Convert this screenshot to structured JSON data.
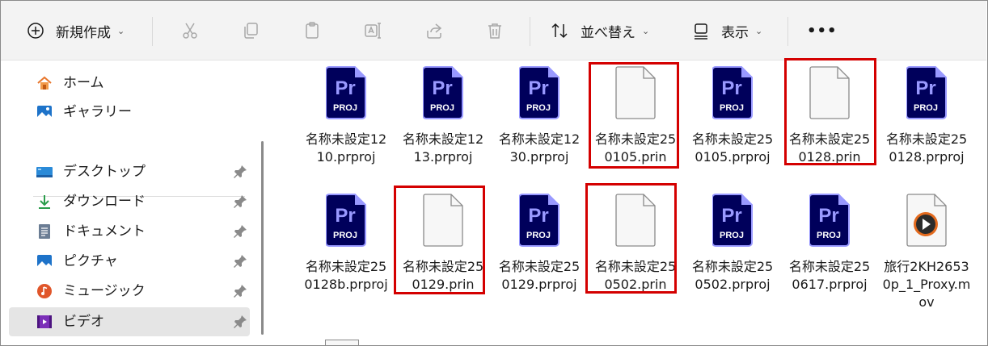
{
  "toolbar": {
    "new_label": "新規作成",
    "sort_label": "並べ替え",
    "view_label": "表示",
    "more_label": "•••"
  },
  "sidebar": {
    "items": [
      {
        "label": "ホーム",
        "icon": "home-icon"
      },
      {
        "label": "ギャラリー",
        "icon": "gallery-icon"
      },
      {
        "label": "デスクトップ",
        "icon": "desktop-icon"
      },
      {
        "label": "ダウンロード",
        "icon": "download-icon"
      },
      {
        "label": "ドキュメント",
        "icon": "documents-icon"
      },
      {
        "label": "ピクチャ",
        "icon": "pictures-icon"
      },
      {
        "label": "ミュージック",
        "icon": "music-icon"
      },
      {
        "label": "ビデオ",
        "icon": "video-icon",
        "selected": true
      }
    ]
  },
  "files": [
    {
      "name": "名称未設定1210.prproj",
      "type": "premiere",
      "highlighted": false
    },
    {
      "name": "名称未設定1213.prproj",
      "type": "premiere",
      "highlighted": false
    },
    {
      "name": "名称未設定1230.prproj",
      "type": "premiere",
      "highlighted": false
    },
    {
      "name": "名称未設定250105.prin",
      "type": "generic",
      "highlighted": true
    },
    {
      "name": "名称未設定250105.prproj",
      "type": "premiere",
      "highlighted": false
    },
    {
      "name": "名称未設定250128.prin",
      "type": "generic",
      "highlighted": true
    },
    {
      "name": "名称未設定250128.prproj",
      "type": "premiere",
      "highlighted": false
    },
    {
      "name": "名称未設定250128b.prproj",
      "type": "premiere",
      "highlighted": false
    },
    {
      "name": "名称未設定250129.prin",
      "type": "generic",
      "highlighted": true
    },
    {
      "name": "名称未設定250129.prproj",
      "type": "premiere",
      "highlighted": false
    },
    {
      "name": "名称未設定250502.prin",
      "type": "generic",
      "highlighted": true
    },
    {
      "name": "名称未設定250502.prproj",
      "type": "premiere",
      "highlighted": false
    },
    {
      "name": "名称未設定250617.prproj",
      "type": "premiere",
      "highlighted": false
    },
    {
      "name": "旅行2KH26530p_1_Proxy.mov",
      "type": "video",
      "highlighted": false
    }
  ],
  "icon_text": {
    "pr": "Pr",
    "proj": "PROJ"
  },
  "colors": {
    "premiere_bg": "#00005b",
    "premiere_accent": "#9999ff",
    "highlight": "#d40000",
    "selected_bg": "#e5e5e5"
  }
}
